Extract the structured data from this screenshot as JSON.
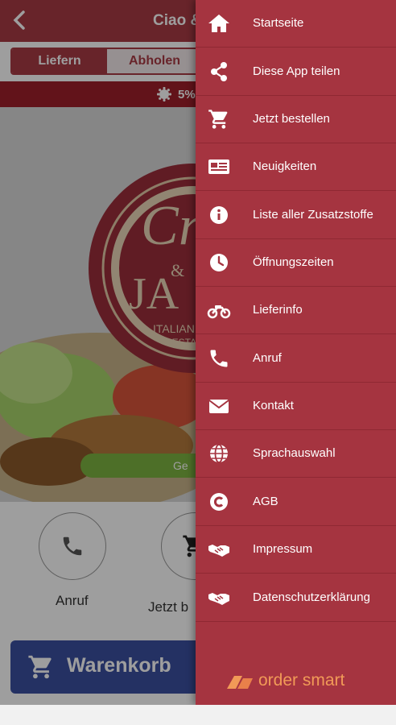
{
  "header": {
    "back_label": "back",
    "title": "Ciao &"
  },
  "order_mode": {
    "deliver": "Liefern",
    "pickup": "Abholen"
  },
  "promo": {
    "text": "5%"
  },
  "hero": {
    "logo_top": "Cr",
    "logo_mid": "JA",
    "logo_amp": "&",
    "logo_line1": "ITALIAN",
    "logo_line2": "RESTA",
    "badge": "Ge"
  },
  "actions": {
    "call": "Anruf",
    "order": "Jetzt b"
  },
  "cart": {
    "label": "Warenkorb"
  },
  "drawer": {
    "items": [
      {
        "label": "Startseite",
        "icon": "home-icon"
      },
      {
        "label": "Diese App teilen",
        "icon": "share-icon"
      },
      {
        "label": "Jetzt bestellen",
        "icon": "cart-icon"
      },
      {
        "label": "Neuigkeiten",
        "icon": "newspaper-icon"
      },
      {
        "label": "Liste aller Zusatzstoffe",
        "icon": "info-icon"
      },
      {
        "label": "Öffnungszeiten",
        "icon": "clock-icon"
      },
      {
        "label": "Lieferinfo",
        "icon": "motorbike-icon"
      },
      {
        "label": "Anruf",
        "icon": "phone-icon"
      },
      {
        "label": "Kontakt",
        "icon": "mail-icon"
      },
      {
        "label": "Sprachauswahl",
        "icon": "globe-icon"
      },
      {
        "label": "AGB",
        "icon": "copyright-icon"
      },
      {
        "label": "Impressum",
        "icon": "handshake-icon"
      },
      {
        "label": "Datenschutzerklärung",
        "icon": "handshake-icon"
      }
    ],
    "brand": "order smart"
  },
  "colors": {
    "primary": "#a53440",
    "promo": "#9e1f2a",
    "cart": "#3b4fa0",
    "brand": "#f19a57"
  }
}
